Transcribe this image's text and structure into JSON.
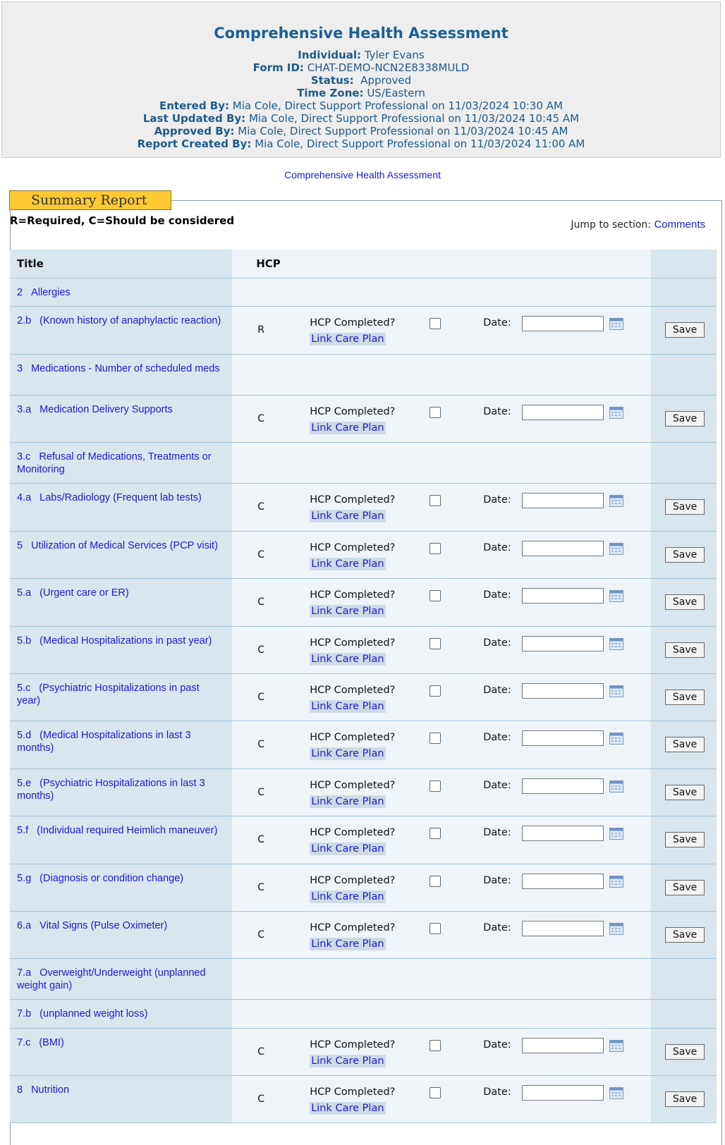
{
  "header": {
    "title": "Comprehensive Health Assessment",
    "individual_label": "Individual:",
    "individual": "Tyler Evans",
    "form_id_label": "Form ID:",
    "form_id": "CHAT-DEMO-NCN2E8338MULD",
    "status_label": "Status:",
    "status": "Approved",
    "timezone_label": "Time Zone:",
    "timezone": "US/Eastern",
    "entered_label": "Entered By:",
    "entered": "Mia Cole, Direct Support Professional on 11/03/2024 10:30 AM",
    "updated_label": "Last Updated By:",
    "updated": "Mia Cole, Direct Support Professional on 11/03/2024 10:45 AM",
    "approved_label": "Approved By:",
    "approved": "Mia Cole, Direct Support Professional on 11/03/2024 10:45 AM",
    "created_label": "Report Created By:",
    "created": "Mia Cole, Direct Support Professional on 11/03/2024 11:00 AM"
  },
  "form_link": "Comprehensive Health Assessment",
  "legend": "Summary Report",
  "req_note": "R=Required, C=Should be considered",
  "jump_label": "Jump to section:",
  "jump_link": "Comments",
  "table_headers": {
    "title": "Title",
    "hcp": "HCP"
  },
  "labels": {
    "hcp_completed": "HCP Completed?",
    "link_care_plan": "Link Care Plan",
    "date": "Date:",
    "save": "Save"
  },
  "rows": [
    {
      "num": "2",
      "title": "Allergies",
      "hcp": ""
    },
    {
      "num": "2.b",
      "title": "(Known history of anaphylactic reaction)",
      "hcp": "R"
    },
    {
      "num": "3",
      "title": "Medications - Number of scheduled meds",
      "hcp": ""
    },
    {
      "num": "3.a",
      "title": "Medication Delivery Supports",
      "hcp": "C"
    },
    {
      "num": "3.c",
      "title": "Refusal of Medications, Treatments or Monitoring",
      "hcp": ""
    },
    {
      "num": "4.a",
      "title": "Labs/Radiology (Frequent lab tests)",
      "hcp": "C"
    },
    {
      "num": "5",
      "title": "Utilization of Medical Services (PCP visit)",
      "hcp": "C"
    },
    {
      "num": "5.a",
      "title": "(Urgent care or ER)",
      "hcp": "C"
    },
    {
      "num": "5.b",
      "title": "(Medical Hospitalizations in past year)",
      "hcp": "C"
    },
    {
      "num": "5.c",
      "title": "(Psychiatric Hospitalizations in past year)",
      "hcp": "C"
    },
    {
      "num": "5.d",
      "title": "(Medical Hospitalizations in last 3 months)",
      "hcp": "C"
    },
    {
      "num": "5.e",
      "title": "(Psychiatric Hospitalizations in last 3 months)",
      "hcp": "C"
    },
    {
      "num": "5.f",
      "title": "(Individual required Heimlich maneuver)",
      "hcp": "C"
    },
    {
      "num": "5.g",
      "title": "(Diagnosis or condition change)",
      "hcp": "C"
    },
    {
      "num": "6.a",
      "title": "Vital Signs (Pulse Oximeter)",
      "hcp": "C"
    },
    {
      "num": "7.a",
      "title": "Overweight/Underweight (unplanned weight gain)",
      "hcp": ""
    },
    {
      "num": "7.b",
      "title": "(unplanned weight loss)",
      "hcp": ""
    },
    {
      "num": "7.c",
      "title": "(BMI)",
      "hcp": "C"
    },
    {
      "num": "8",
      "title": "Nutrition",
      "hcp": "C"
    }
  ],
  "colors": {
    "header_title": "#1c5f96",
    "legend_bg": "#ffc934",
    "link": "#1a1adc"
  }
}
